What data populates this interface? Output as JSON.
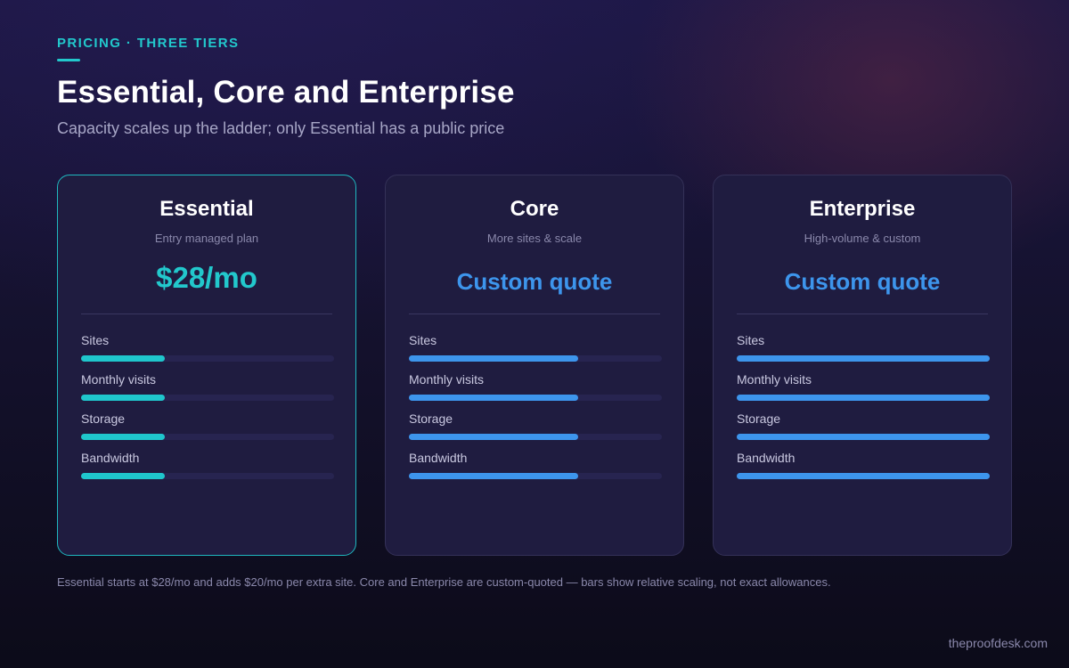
{
  "header": {
    "eyebrow": "PRICING · THREE TIERS",
    "title": "Essential, Core and Enterprise",
    "subtitle": "Capacity scales up the ladder; only Essential has a public price"
  },
  "tiers": [
    {
      "name": "Essential",
      "tagline": "Entry managed plan",
      "price": "$28/mo",
      "metrics": [
        {
          "label": "Sites",
          "level": 0.33
        },
        {
          "label": "Monthly visits",
          "level": 0.33
        },
        {
          "label": "Storage",
          "level": 0.33
        },
        {
          "label": "Bandwidth",
          "level": 0.33
        }
      ]
    },
    {
      "name": "Core",
      "tagline": "More sites & scale",
      "price": "Custom quote",
      "metrics": [
        {
          "label": "Sites",
          "level": 0.67
        },
        {
          "label": "Monthly visits",
          "level": 0.67
        },
        {
          "label": "Storage",
          "level": 0.67
        },
        {
          "label": "Bandwidth",
          "level": 0.67
        }
      ]
    },
    {
      "name": "Enterprise",
      "tagline": "High-volume & custom",
      "price": "Custom quote",
      "metrics": [
        {
          "label": "Sites",
          "level": 1.0
        },
        {
          "label": "Monthly visits",
          "level": 1.0
        },
        {
          "label": "Storage",
          "level": 1.0
        },
        {
          "label": "Bandwidth",
          "level": 1.0
        }
      ]
    }
  ],
  "footnote": "Essential starts at $28/mo and adds $20/mo per extra site. Core and Enterprise are custom-quoted — bars show relative scaling, not exact allowances.",
  "brand": "theproofdesk.com",
  "colors": {
    "accent_teal": "#22c8cc",
    "accent_blue": "#3d95ec",
    "card_bg": "#1f1c40",
    "highlight_border": "#1fb8bf"
  }
}
